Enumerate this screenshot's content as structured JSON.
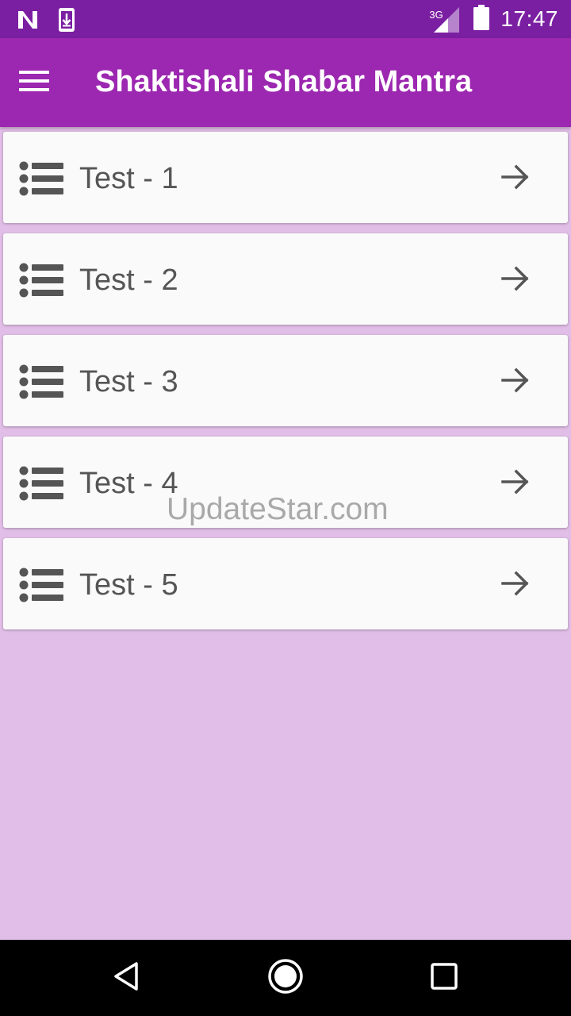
{
  "status_bar": {
    "time": "17:47",
    "network_label": "3G",
    "icons": [
      "notification-n-icon",
      "download-notification-icon",
      "signal-icon",
      "battery-icon"
    ]
  },
  "app_bar": {
    "title": "Shaktishali Shabar Mantra",
    "menu_icon": "hamburger-menu-icon"
  },
  "list": {
    "items": [
      {
        "label": "Test - 1"
      },
      {
        "label": "Test - 2"
      },
      {
        "label": "Test - 3"
      },
      {
        "label": "Test - 4"
      },
      {
        "label": "Test - 5"
      }
    ],
    "item_icon": "list-icon",
    "item_action_icon": "arrow-right-icon"
  },
  "watermark": "UpdateStar.com",
  "nav_bar": {
    "icons": [
      "back-triangle-icon",
      "home-circle-icon",
      "recents-square-icon"
    ]
  },
  "colors": {
    "status_bar": "#7b1fa2",
    "app_bar": "#9c27b0",
    "background": "#e1bee7",
    "card": "#fafafa",
    "item_text": "#555555",
    "nav_bar": "#000000"
  }
}
